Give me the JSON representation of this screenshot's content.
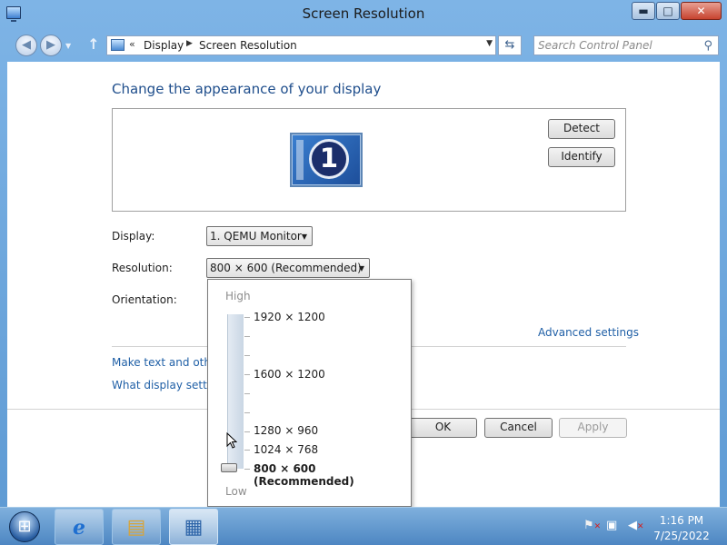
{
  "window": {
    "title": "Screen Resolution",
    "controls": {
      "minimize": "▬",
      "maximize": "□",
      "close": "✕"
    }
  },
  "navigation": {
    "back_icon": "◀",
    "forward_icon": "▶",
    "history_icon": "▼",
    "up_icon": "↑",
    "breadcrumb": {
      "separator_start": "«",
      "items": [
        "Display",
        "Screen Resolution"
      ],
      "separator": "▶"
    },
    "refresh_icon": "⇆",
    "search_placeholder": "Search Control Panel",
    "search_icon": "⚲"
  },
  "main": {
    "heading": "Change the appearance of your display",
    "monitor_number": "1",
    "detect_label": "Detect",
    "identify_label": "Identify",
    "display_label": "Display:",
    "display_value": "1. QEMU Monitor",
    "resolution_label": "Resolution:",
    "resolution_value": "800 × 600 (Recommended)",
    "orientation_label": "Orientation:",
    "advanced_link": "Advanced settings",
    "text_size_link": "Make text and other",
    "display_settings_link": "What display setting",
    "ok_label": "OK",
    "cancel_label": "Cancel",
    "apply_label": "Apply"
  },
  "resolution_popup": {
    "high_label": "High",
    "low_label": "Low",
    "options": [
      "1920 × 1200",
      "1600 × 1200",
      "1280 × 960",
      "1024 × 768",
      "800 × 600 (Recommended)"
    ],
    "selected_index": 4
  },
  "taskbar": {
    "pinned": [
      "internet-explorer",
      "windows-explorer",
      "control-panel"
    ],
    "active": "control-panel",
    "time": "1:16 PM",
    "date": "7/25/2022"
  },
  "colors": {
    "link": "#1f5fa6",
    "heading": "#1f4e8c",
    "window_frame": "#6fa8dc"
  }
}
